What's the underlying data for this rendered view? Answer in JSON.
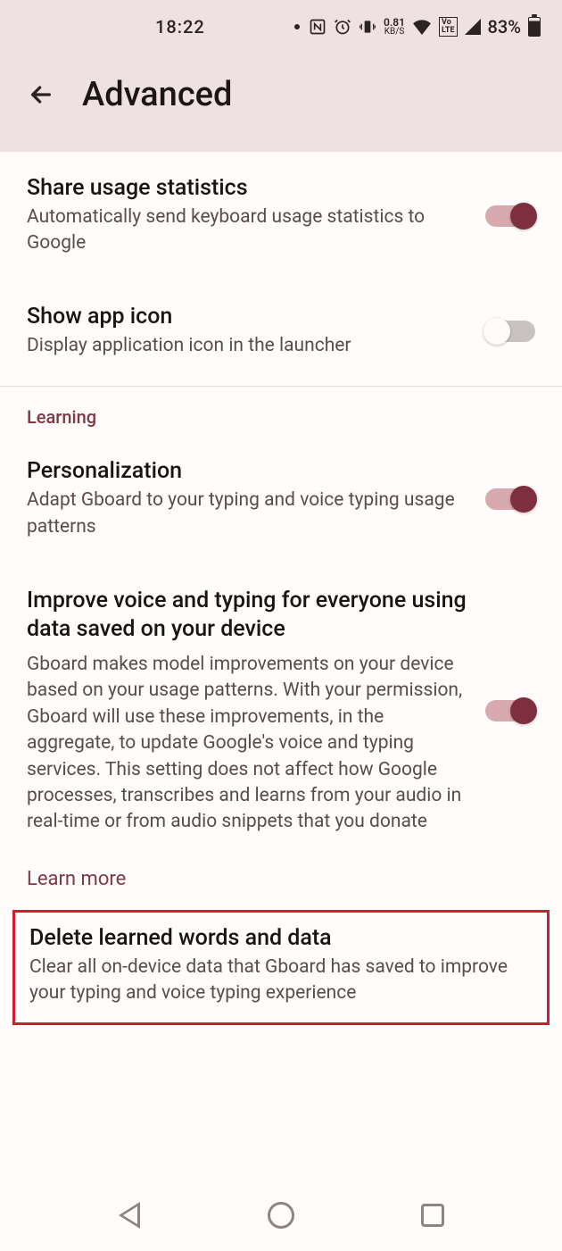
{
  "status": {
    "time": "18:22",
    "kbs_val": "0.81",
    "kbs_unit": "KB/S",
    "battery_pct": "83%"
  },
  "header": {
    "title": "Advanced"
  },
  "prefs": {
    "share_stats": {
      "title": "Share usage statistics",
      "sub": "Automatically send keyboard usage statistics to Google"
    },
    "show_icon": {
      "title": "Show app icon",
      "sub": "Display application icon in the launcher"
    },
    "learning_cat": "Learning",
    "personalization": {
      "title": "Personalization",
      "sub": "Adapt Gboard to your typing and voice typing usage patterns"
    },
    "improve": {
      "title": "Improve voice and typing for everyone using data saved on your device",
      "sub": "Gboard makes model improvements on your device based on your usage patterns. With your permission, Gboard will use these improvements, in the aggregate, to update Google's voice and typing services. This setting does not affect how Google processes, transcribes and learns from your audio in real-time or from audio snippets that you donate"
    },
    "learn_more": "Learn more",
    "delete": {
      "title": "Delete learned words and data",
      "sub": "Clear all on-device data that Gboard has saved to improve your typing and voice typing experience"
    }
  }
}
